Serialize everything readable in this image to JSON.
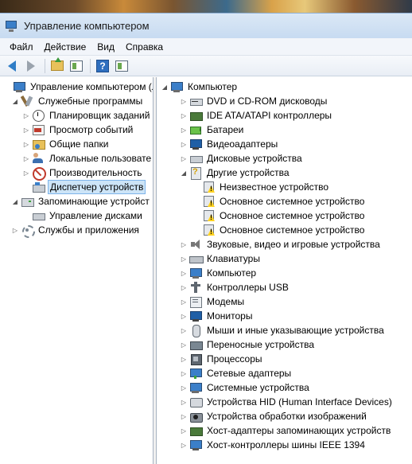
{
  "window": {
    "title": "Управление компьютером"
  },
  "menu": [
    "Файл",
    "Действие",
    "Вид",
    "Справка"
  ],
  "left_tree": [
    {
      "label": "Управление компьютером (л",
      "icon": "computer-management-icon",
      "expander": ""
    },
    {
      "label": "Служебные программы",
      "icon": "tools-icon",
      "expander": "◢"
    },
    {
      "label": "Планировщик заданий",
      "icon": "clock-icon",
      "expander": "▷"
    },
    {
      "label": "Просмотр событий",
      "icon": "event-viewer-icon",
      "expander": "▷"
    },
    {
      "label": "Общие папки",
      "icon": "shared-folders-icon",
      "expander": "▷"
    },
    {
      "label": "Локальные пользовате",
      "icon": "users-icon",
      "expander": "▷"
    },
    {
      "label": "Производительность",
      "icon": "performance-icon",
      "expander": "▷"
    },
    {
      "label": "Диспетчер устройств",
      "icon": "device-manager-icon",
      "expander": "",
      "selected": true
    },
    {
      "label": "Запоминающие устройст",
      "icon": "storage-icon",
      "expander": "◢"
    },
    {
      "label": "Управление дисками",
      "icon": "disk-management-icon",
      "expander": ""
    },
    {
      "label": "Службы и приложения",
      "icon": "services-icon",
      "expander": "▷"
    }
  ],
  "right_tree": [
    {
      "label": "Компьютер",
      "icon": "computer-icon",
      "expander": "◢",
      "level": 0
    },
    {
      "label": "DVD и CD-ROM дисководы",
      "icon": "dvd-icon",
      "expander": "▷",
      "level": 1
    },
    {
      "label": "IDE ATA/ATAPI контроллеры",
      "icon": "ide-controller-icon",
      "expander": "▷",
      "level": 1
    },
    {
      "label": "Батареи",
      "icon": "battery-icon",
      "expander": "▷",
      "level": 1
    },
    {
      "label": "Видеоадаптеры",
      "icon": "video-adapter-icon",
      "expander": "▷",
      "level": 1
    },
    {
      "label": "Дисковые устройства",
      "icon": "disk-drive-icon",
      "expander": "▷",
      "level": 1
    },
    {
      "label": "Другие устройства",
      "icon": "other-devices-icon",
      "expander": "◢",
      "level": 1
    },
    {
      "label": "Неизвестное устройство",
      "icon": "warning-device-icon",
      "expander": "",
      "level": 2
    },
    {
      "label": "Основное системное устройство",
      "icon": "warning-device-icon",
      "expander": "",
      "level": 2
    },
    {
      "label": "Основное системное устройство",
      "icon": "warning-device-icon",
      "expander": "",
      "level": 2
    },
    {
      "label": "Основное системное устройство",
      "icon": "warning-device-icon",
      "expander": "",
      "level": 2
    },
    {
      "label": "Звуковые, видео и игровые устройства",
      "icon": "sound-icon",
      "expander": "▷",
      "level": 1
    },
    {
      "label": "Клавиатуры",
      "icon": "keyboard-icon",
      "expander": "▷",
      "level": 1
    },
    {
      "label": "Компьютер",
      "icon": "computer-icon",
      "expander": "▷",
      "level": 1
    },
    {
      "label": "Контроллеры USB",
      "icon": "usb-icon",
      "expander": "▷",
      "level": 1
    },
    {
      "label": "Модемы",
      "icon": "modem-icon",
      "expander": "▷",
      "level": 1
    },
    {
      "label": "Мониторы",
      "icon": "monitor-icon",
      "expander": "▷",
      "level": 1
    },
    {
      "label": "Мыши и иные указывающие устройства",
      "icon": "mouse-icon",
      "expander": "▷",
      "level": 1
    },
    {
      "label": "Переносные устройства",
      "icon": "portable-device-icon",
      "expander": "▷",
      "level": 1
    },
    {
      "label": "Процессоры",
      "icon": "processor-icon",
      "expander": "▷",
      "level": 1
    },
    {
      "label": "Сетевые адаптеры",
      "icon": "network-adapter-icon",
      "expander": "▷",
      "level": 1
    },
    {
      "label": "Системные устройства",
      "icon": "system-device-icon",
      "expander": "▷",
      "level": 1
    },
    {
      "label": "Устройства HID (Human Interface Devices)",
      "icon": "hid-icon",
      "expander": "▷",
      "level": 1
    },
    {
      "label": "Устройства обработки изображений",
      "icon": "imaging-icon",
      "expander": "▷",
      "level": 1
    },
    {
      "label": "Хост-адаптеры запоминающих устройств",
      "icon": "storage-controller-icon",
      "expander": "▷",
      "level": 1
    },
    {
      "label": "Хост-контроллеры шины IEEE 1394",
      "icon": "ieee1394-icon",
      "expander": "▷",
      "level": 1
    }
  ]
}
